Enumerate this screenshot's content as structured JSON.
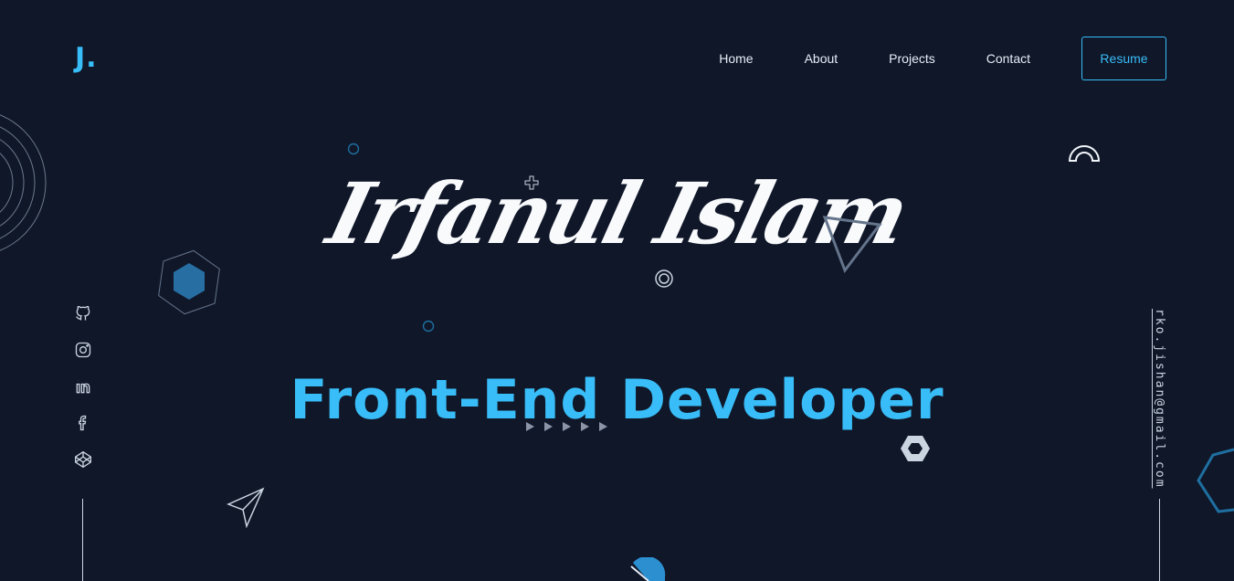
{
  "logo": "J.",
  "nav": {
    "items": [
      "Home",
      "About",
      "Projects",
      "Contact"
    ],
    "resume": "Resume"
  },
  "hero": {
    "name": "Irfanul Islam",
    "role": "Front-End Developer"
  },
  "social": [
    "github-icon",
    "instagram-icon",
    "linkedin-icon",
    "facebook-icon",
    "codepen-icon"
  ],
  "email": "rko.jishan@gmail.com",
  "colors": {
    "background": "#101729",
    "accent": "#38bdf8",
    "text": "#e6edf7"
  }
}
